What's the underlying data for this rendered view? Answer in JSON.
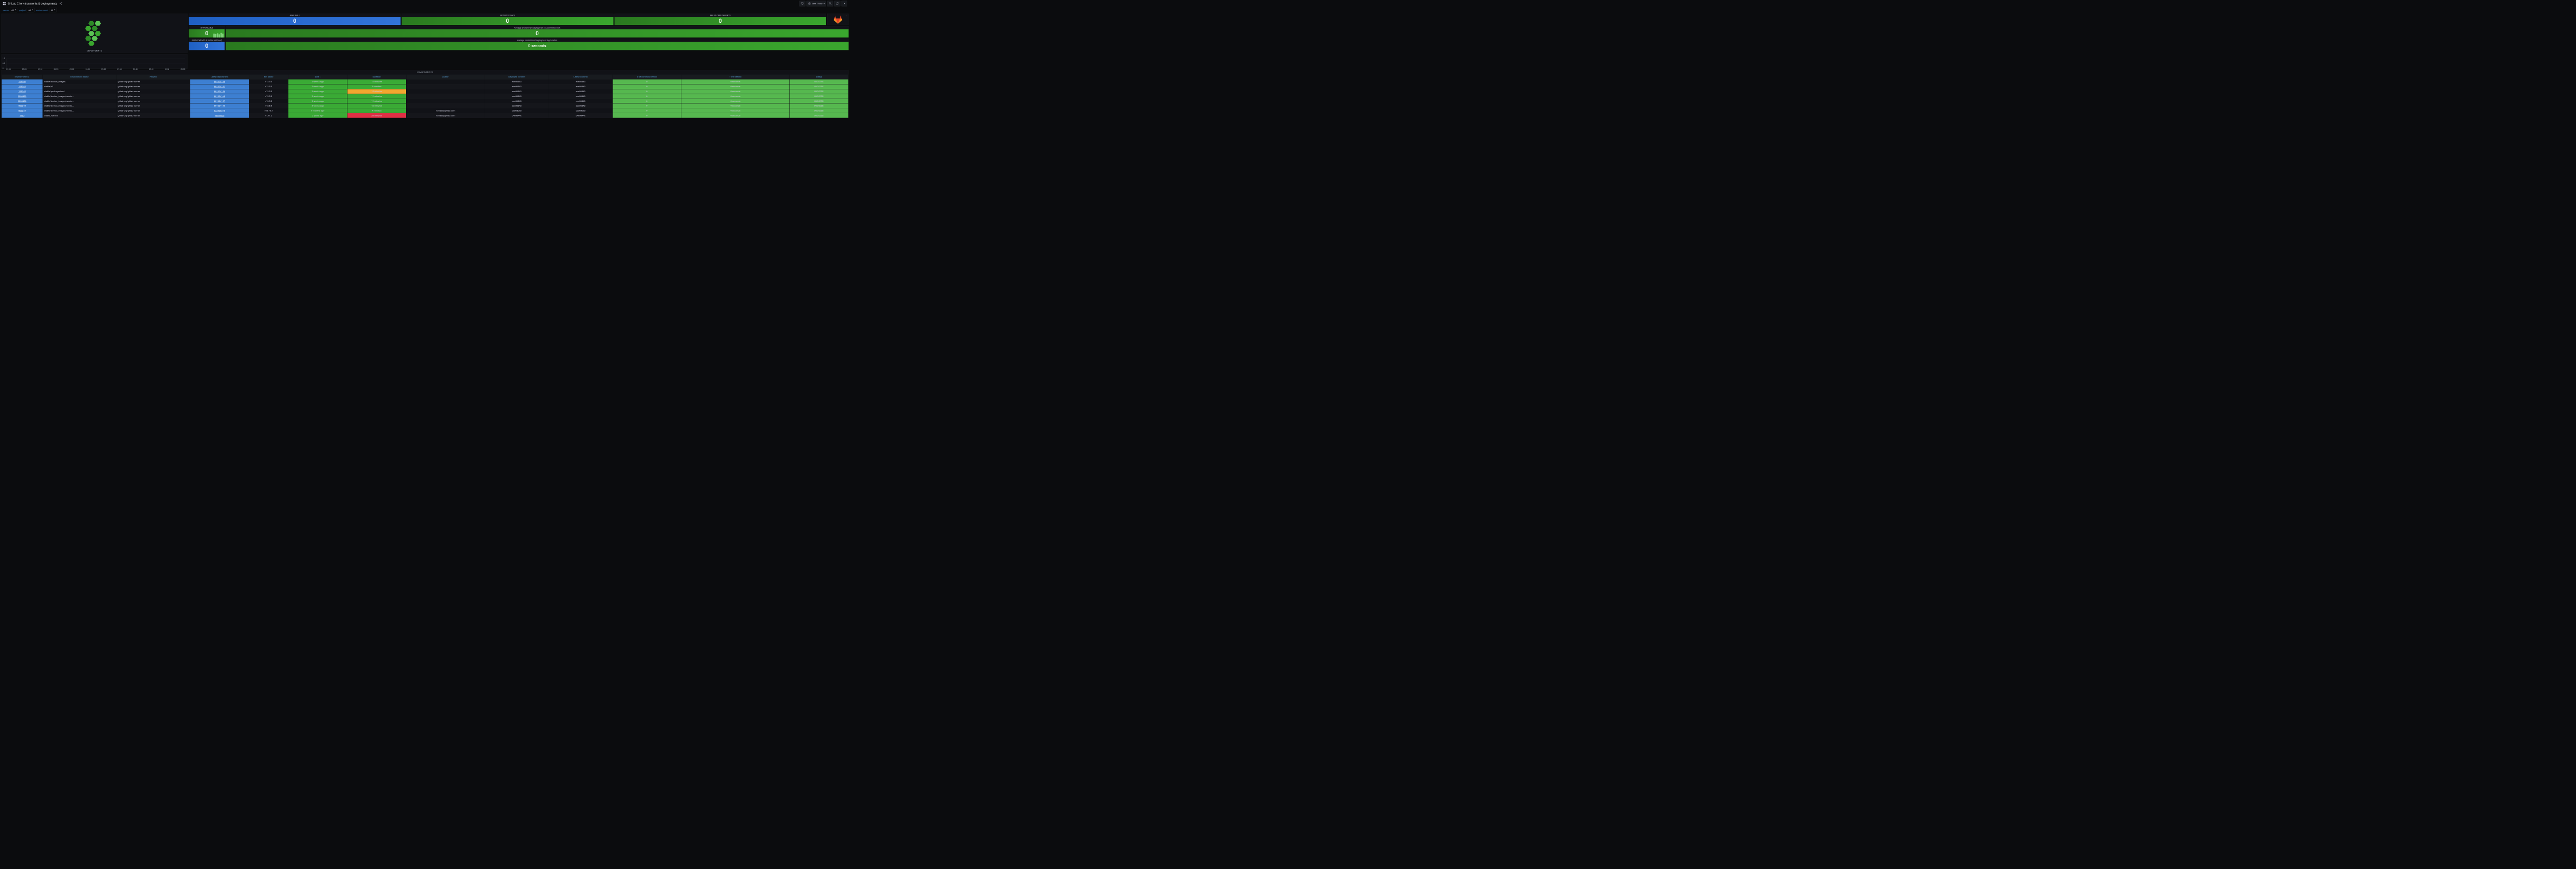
{
  "header": {
    "title": "GitLab CI environments & deployments",
    "time_label": "Last 1 hour"
  },
  "vars": [
    {
      "label": "owner",
      "value": "All"
    },
    {
      "label": "project",
      "value": "All"
    },
    {
      "label": "environment",
      "value": "All"
    }
  ],
  "panels": {
    "deployments_title": "DEPLOYMENTS",
    "environments_title": "ENVIRONMENTS"
  },
  "stats": {
    "available": {
      "label": "AVAILABLE",
      "value": "0"
    },
    "not_up_to_date": {
      "label": "NOT UP TO DATE",
      "value": "0"
    },
    "failed": {
      "label": "FAILED DEPLOYMENTS",
      "value": "0"
    },
    "unavailable": {
      "label": "UNAVAILABLE",
      "value": "0"
    },
    "lag_commits": {
      "label": "Average environment deployment lag commits count",
      "value": "0"
    },
    "deploy_count": {
      "label": "DEPLOYMENTS # (in the last hour)",
      "value": "0"
    },
    "lag_duration": {
      "label": "Average environment deployment lag duration",
      "value": "0 seconds"
    }
  },
  "chart_data": {
    "type": "bar",
    "title": "DEPLOYMENTS",
    "x_ticks": [
      "09:00",
      "09:05",
      "09:10",
      "09:15",
      "09:20",
      "09:25",
      "09:30",
      "09:35",
      "09:40",
      "09:45",
      "09:50",
      "09:55"
    ],
    "y_ticks": [
      "0",
      "0.5",
      "1.0"
    ],
    "xlabel": "",
    "ylabel": "",
    "ylim": [
      0,
      1.0
    ],
    "values": []
  },
  "table": {
    "columns": [
      "Environment ID",
      "Environment Name",
      "Project",
      "Latest deployment",
      "Ref Name",
      "Date ↓",
      "Duration",
      "Author",
      "Deployed commit",
      "Latest commit",
      "# of commits behind",
      "Time behind",
      "Status"
    ],
    "rows": [
      {
        "id": "128146",
        "name": "stable/docker_images",
        "project": "gitlab-org/gitlab-runner",
        "deploy": "801324155",
        "ref": "v13.5.0",
        "date": "2 weeks ago",
        "duration": "13 minutes",
        "dur_class": "green",
        "author": "",
        "dcommit": "ece86343",
        "lcommit": "ece86343",
        "behind": "0",
        "timebehind": "0 seconds",
        "status": "SUCCESS"
      },
      {
        "id": "128144",
        "name": "stable/s3",
        "project": "gitlab-org/gitlab-runner",
        "deploy": "801324151",
        "ref": "v13.5.0",
        "date": "2 weeks ago",
        "duration": "3 minutes",
        "dur_class": "green",
        "author": "",
        "dcommit": "ece86343",
        "lcommit": "ece86343",
        "behind": "0",
        "timebehind": "0 seconds",
        "status": "SUCCESS"
      },
      {
        "id": "128145",
        "name": "stable/packagecloud",
        "project": "gitlab-org/gitlab-runner",
        "deploy": "801324154",
        "ref": "v13.5.0",
        "date": "2 weeks ago",
        "duration": "15 minutes",
        "dur_class": "orange",
        "author": "",
        "dcommit": "ece86343",
        "lcommit": "ece86343",
        "behind": "0",
        "timebehind": "0 seconds",
        "status": "SUCCESS"
      },
      {
        "id": "2008459",
        "name": "stable/docker_images/windo...",
        "project": "gitlab-org/gitlab-runner",
        "deploy": "801324160",
        "ref": "v13.5.0",
        "date": "2 weeks ago",
        "duration": "11 minutes",
        "dur_class": "green",
        "author": "",
        "dcommit": "ece86343",
        "lcommit": "ece86343",
        "behind": "0",
        "timebehind": "0 seconds",
        "status": "SUCCESS"
      },
      {
        "id": "2008458",
        "name": "stable/docker_images/windo...",
        "project": "gitlab-org/gitlab-runner",
        "deploy": "801324157",
        "ref": "v13.5.0",
        "date": "2 weeks ago",
        "duration": "11 minutes",
        "dur_class": "green",
        "author": "",
        "dcommit": "ece86343",
        "lcommit": "ece86343",
        "behind": "0",
        "timebehind": "0 seconds",
        "status": "SUCCESS"
      },
      {
        "id": "602215",
        "name": "stable/docker_images/windo...",
        "project": "gitlab-org/gitlab-runner",
        "deploy": "801324156",
        "ref": "v13.5.0",
        "date": "2 weeks ago",
        "duration": "12 minutes",
        "dur_class": "green",
        "author": "",
        "dcommit": "ece86343",
        "lcommit": "ece86343",
        "behind": "0",
        "timebehind": "0 seconds",
        "status": "SUCCESS"
      },
      {
        "id": "602214",
        "name": "stable/docker_images/windo...",
        "project": "gitlab-org/gitlab-runner",
        "deploy": "522635376",
        "ref": "v12.10.1",
        "date": "6 months ago",
        "duration": "4 minutes",
        "dur_class": "green",
        "author": "tomasz@gitlab.com",
        "dcommit": "ce065b93",
        "lcommit": "ce065b93",
        "behind": "0",
        "timebehind": "0 seconds",
        "status": "SUCCESS"
      },
      {
        "id": "1107",
        "name": "stable_release",
        "project": "gitlab-org/gitlab-runner",
        "deploy": "13652662",
        "ref": "v1.11.2",
        "date": "3 years ago",
        "duration": "28 minutes",
        "dur_class": "red",
        "author": "tomasz@gitlab.com",
        "dcommit": "0489844c",
        "lcommit": "0489844c",
        "behind": "0",
        "timebehind": "0 seconds",
        "status": "SUCCESS"
      }
    ]
  }
}
